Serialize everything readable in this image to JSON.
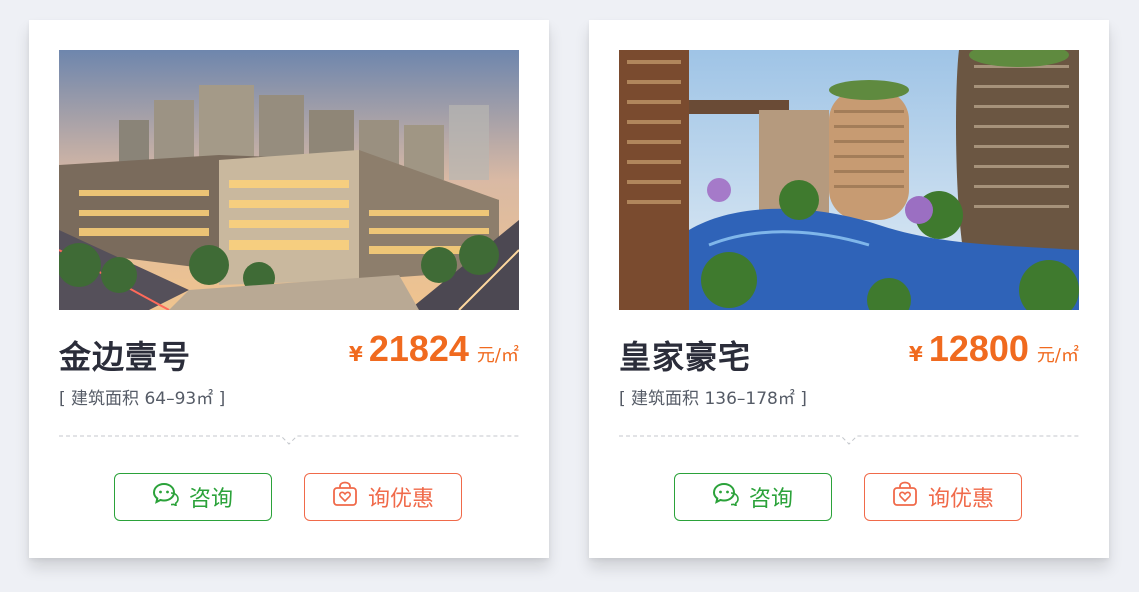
{
  "cards": [
    {
      "name": "金边壹号",
      "currency": "¥",
      "price": "21824",
      "unit": "元/㎡",
      "area": "[ 建筑面积 64–93㎡ ]",
      "consult_label": "咨询",
      "discount_label": "询优惠",
      "photo_subject": "commercial street buildings at dusk"
    },
    {
      "name": "皇家豪宅",
      "currency": "¥",
      "price": "12800",
      "unit": "元/㎡",
      "area": "[ 建筑面积 136–178㎡ ]",
      "consult_label": "咨询",
      "discount_label": "询优惠",
      "photo_subject": "resort towers with pool"
    }
  ],
  "icons": {
    "consult": "wechat-chat-icon",
    "discount": "shopping-bag-heart-icon"
  },
  "colors": {
    "price": "#f06a1f",
    "consult": "#2ba23a",
    "discount": "#f06a4a",
    "title": "#2b2d3a"
  }
}
